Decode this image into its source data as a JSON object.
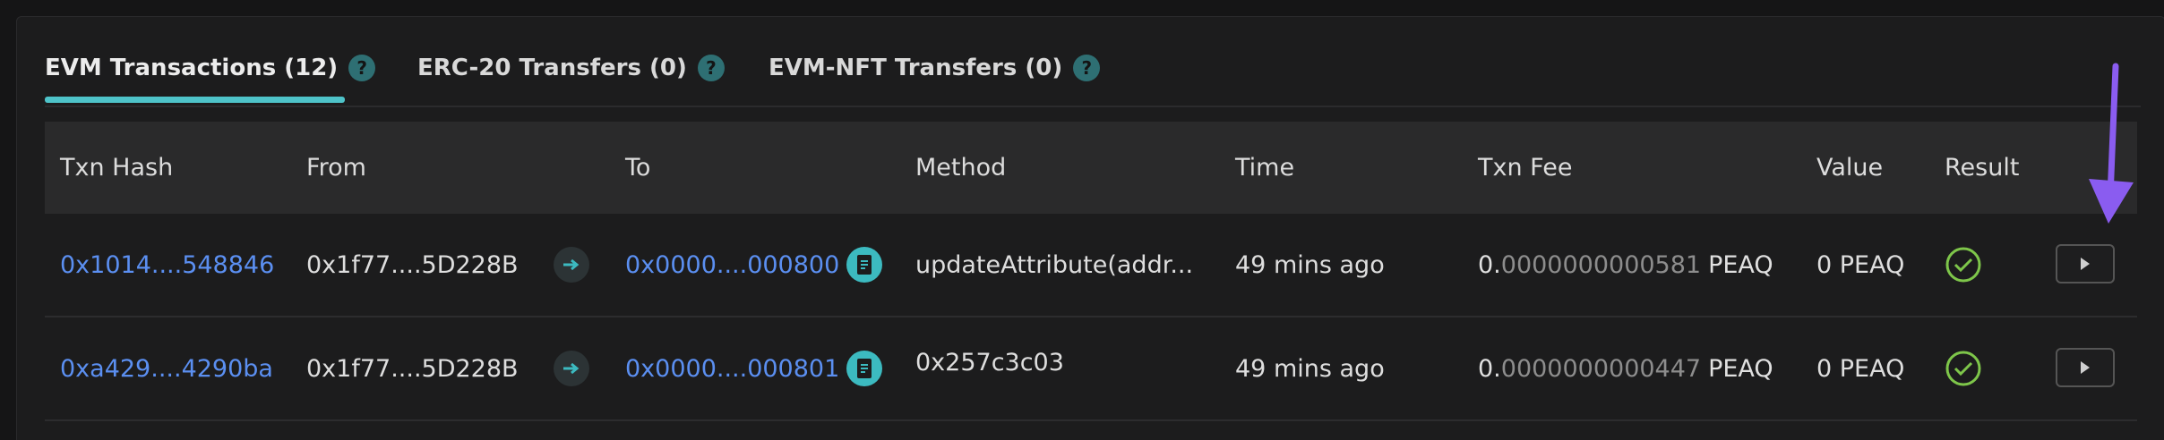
{
  "tabs": [
    {
      "label": "EVM Transactions (12)",
      "help": "?"
    },
    {
      "label": "ERC-20 Transfers (0)",
      "help": "?"
    },
    {
      "label": "EVM-NFT Transfers (0)",
      "help": "?"
    }
  ],
  "active_tab": 0,
  "table": {
    "headers": [
      "Txn Hash",
      "From",
      "To",
      "Method",
      "Time",
      "Txn Fee",
      "Value",
      "Result"
    ],
    "rows": [
      {
        "hash": "0x1014....548846",
        "from": "0x1f77....5D228B",
        "to": "0x0000....000800",
        "method": "updateAttribute(addr...",
        "time": "49 mins ago",
        "fee_zero": "0.",
        "fee_rest": "0000000000581",
        "fee_unit": "PEAQ",
        "value": "0 PEAQ",
        "result": "success"
      },
      {
        "hash": "0xa429....4290ba",
        "from": "0x1f77....5D228B",
        "to": "0x0000....000801",
        "method": "0x257c3c03",
        "time": "49 mins ago",
        "fee_zero": "0.",
        "fee_rest": "0000000000447",
        "fee_unit": "PEAQ",
        "value": "0 PEAQ",
        "result": "success"
      }
    ]
  },
  "colors": {
    "link": "#5b8ff1",
    "accent": "#4ec3c9",
    "success": "#7ec64a",
    "annotation": "#8a5cf0"
  },
  "icons": [
    "help-icon",
    "arrow-right-icon",
    "contract-doc-icon",
    "check-circle-icon",
    "play-icon"
  ]
}
